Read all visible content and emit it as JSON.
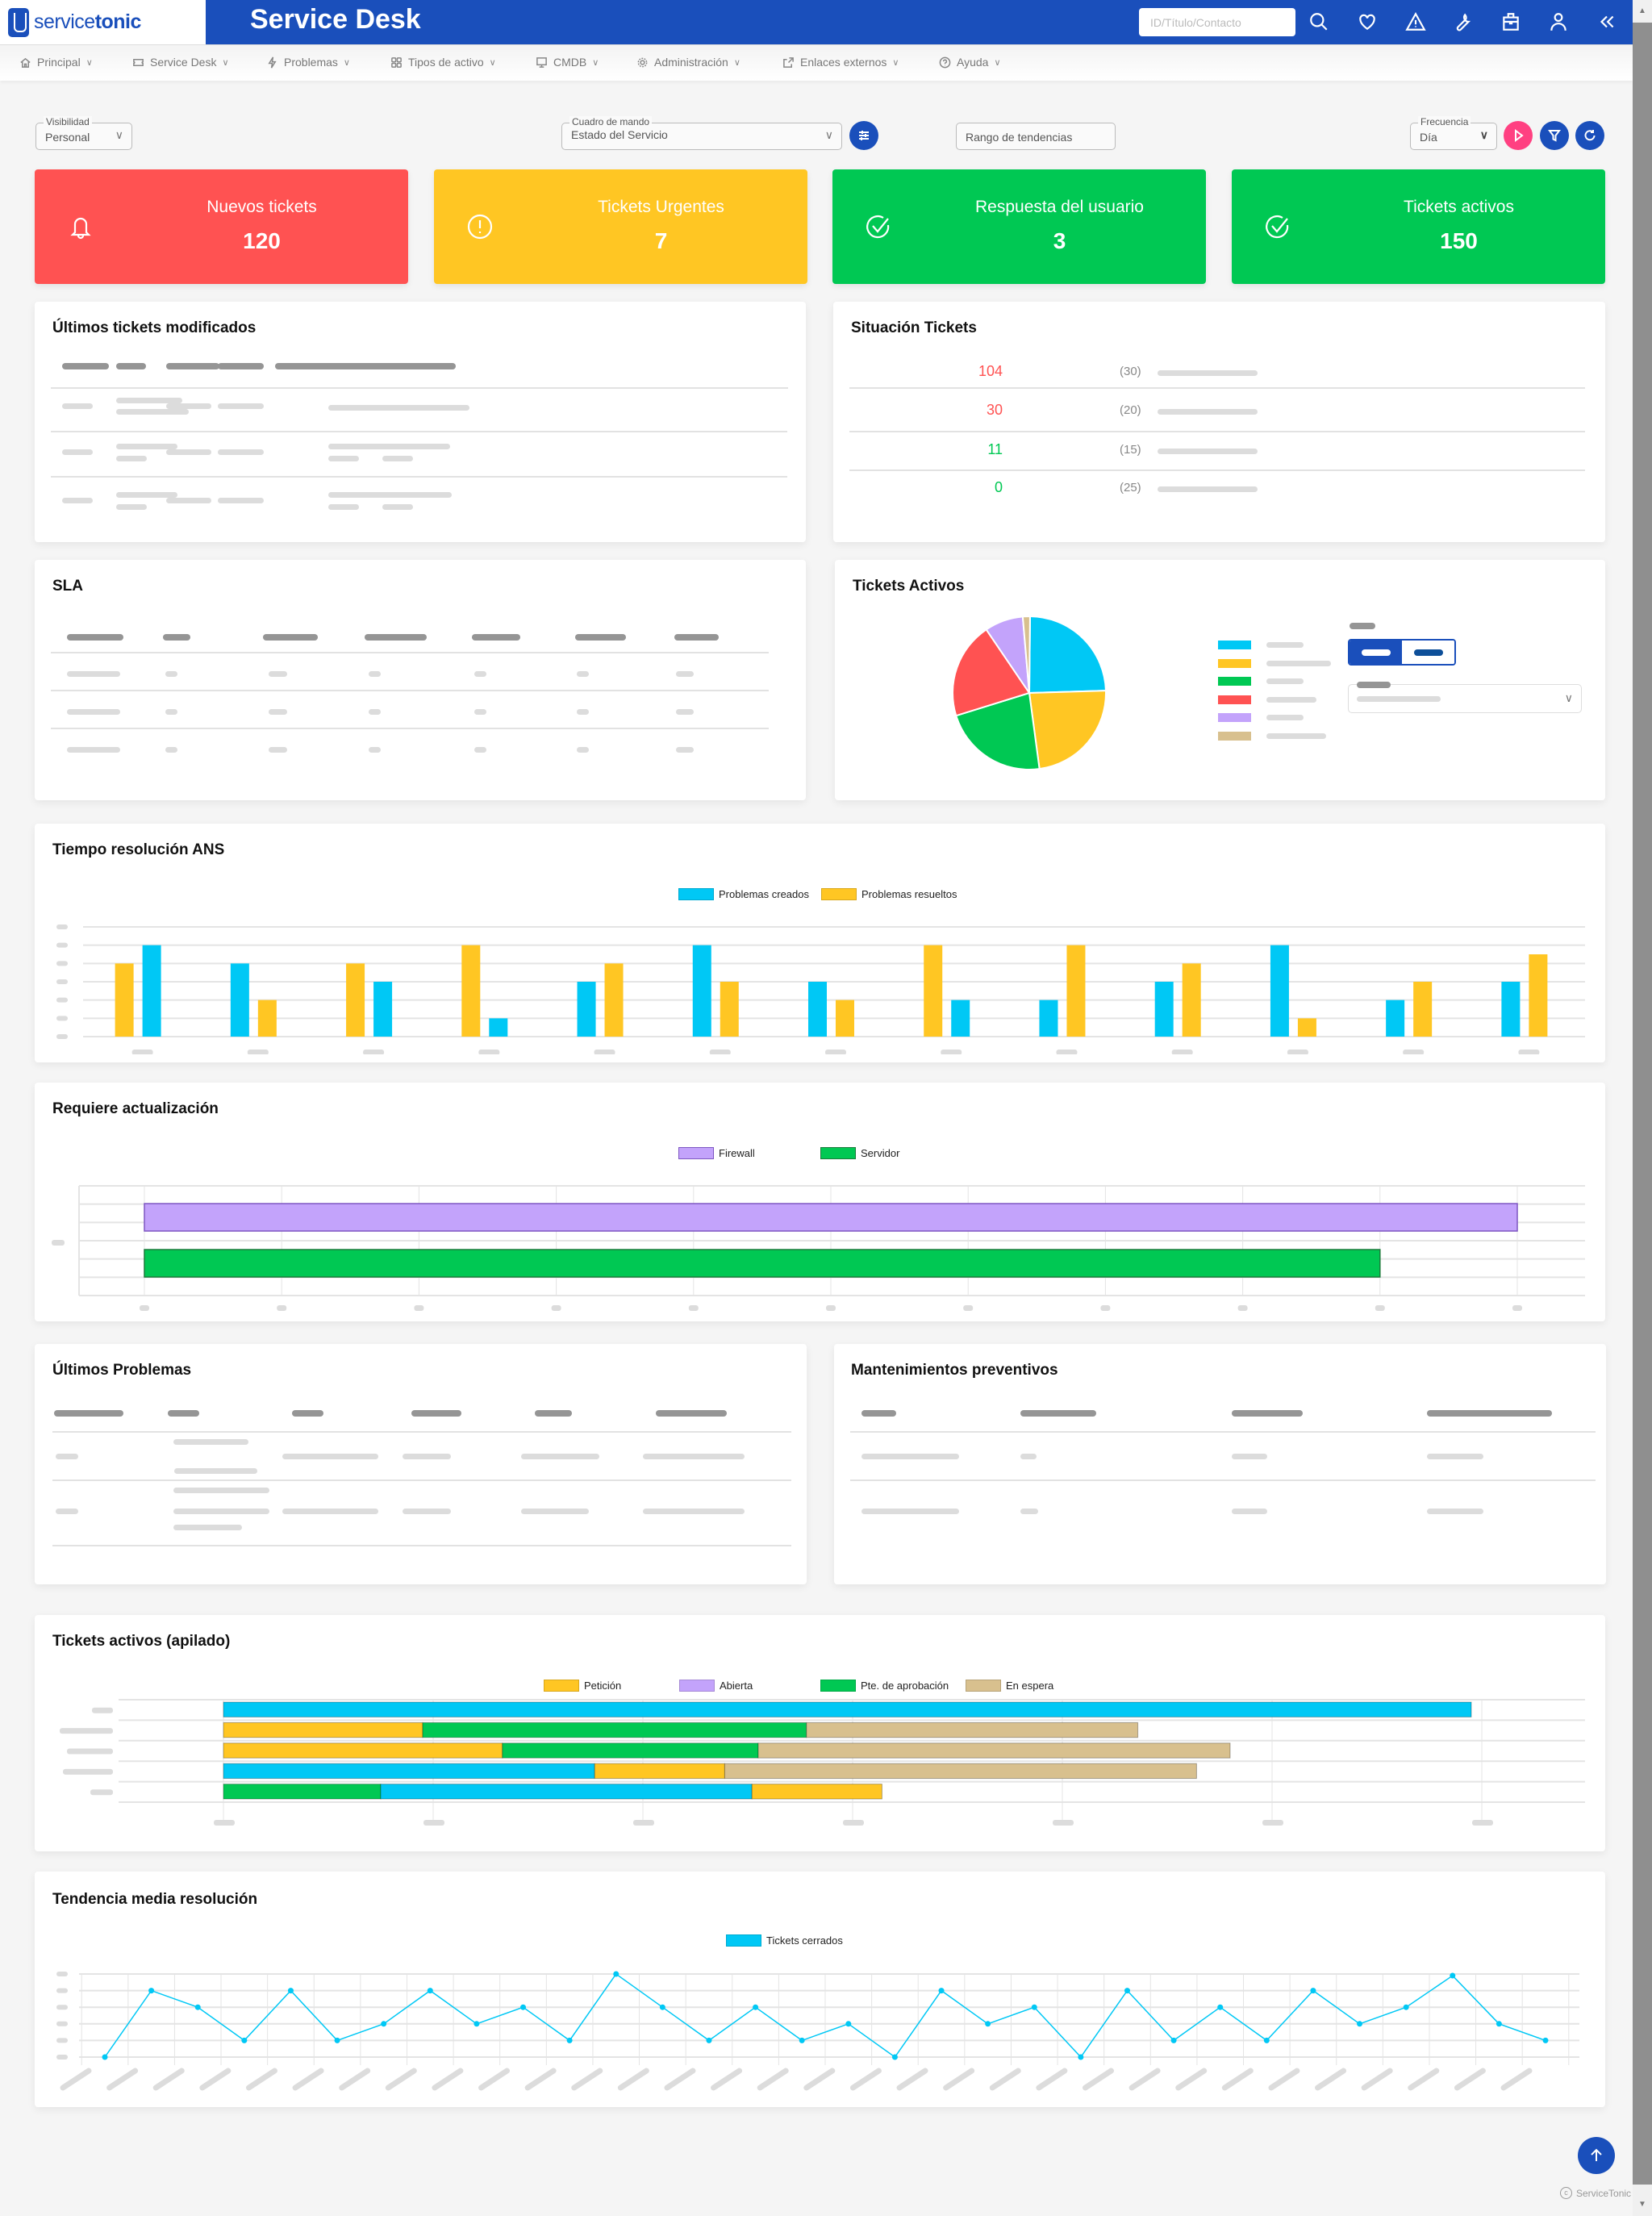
{
  "header": {
    "logo_prefix": "service",
    "logo_bold": "tonic",
    "title": "Service Desk",
    "search_placeholder": "ID/Título/Contacto",
    "icons": [
      "search-icon",
      "heart-icon",
      "warning-icon",
      "wrench-icon",
      "toolbox-icon",
      "user-icon",
      "collapse-icon"
    ]
  },
  "nav": [
    {
      "label": "Principal",
      "icon": "home-icon"
    },
    {
      "label": "Service Desk",
      "icon": "ticket-icon"
    },
    {
      "label": "Problemas",
      "icon": "bolt-icon"
    },
    {
      "label": "Tipos de activo",
      "icon": "grid-icon"
    },
    {
      "label": "CMDB",
      "icon": "monitor-icon"
    },
    {
      "label": "Administración",
      "icon": "gear-icon"
    },
    {
      "label": "Enlaces externos",
      "icon": "external-link-icon"
    },
    {
      "label": "Ayuda",
      "icon": "help-icon"
    }
  ],
  "filters": {
    "visibilidad": {
      "label": "Visibilidad",
      "value": "Personal"
    },
    "cuadro": {
      "label": "Cuadro de mando",
      "value": "Estado del Servicio"
    },
    "rango": {
      "placeholder": "Rango de tendencias"
    },
    "frecuencia": {
      "label": "Frecuencia",
      "value": "Día"
    }
  },
  "kpis": [
    {
      "label": "Nuevos tickets",
      "value": "120",
      "color": "#ff5252",
      "icon": "bell-icon"
    },
    {
      "label": "Tickets Urgentes",
      "value": "7",
      "color": "#ffc623",
      "icon": "alert-circle-icon"
    },
    {
      "label": "Respuesta del usuario",
      "value": "3",
      "color": "#00c853",
      "icon": "check-circle-icon"
    },
    {
      "label": "Tickets activos",
      "value": "150",
      "color": "#00c853",
      "icon": "check-circle-icon"
    }
  ],
  "cards": {
    "ultimos_tickets": "Últimos tickets modificados",
    "situacion": "Situación Tickets",
    "sla": "SLA",
    "tickets_activos": "Tickets Activos",
    "tiempo_ans": "Tiempo resolución ANS",
    "requiere": "Requiere actualización",
    "ultimos_problemas": "Últimos Problemas",
    "mantenimientos": "Mantenimientos preventivos",
    "apilado": "Tickets activos (apilado)",
    "tendencia": "Tendencia media resolución"
  },
  "situacion": [
    {
      "value": "104",
      "count": "(30)",
      "color": "#ff5252"
    },
    {
      "value": "30",
      "count": "(20)",
      "color": "#ff5252"
    },
    {
      "value": "11",
      "count": "(15)",
      "color": "#00c853"
    },
    {
      "value": "0",
      "count": "(25)",
      "color": "#00c853"
    }
  ],
  "footer": {
    "copyright": "ServiceTonic"
  },
  "chart_data": [
    {
      "id": "tickets-activos-pie",
      "type": "pie",
      "title": "Tickets Activos",
      "slices": [
        {
          "value": 24,
          "color": "#00c8f5"
        },
        {
          "value": 23,
          "color": "#ffc623"
        },
        {
          "value": 22,
          "color": "#00c853"
        },
        {
          "value": 20,
          "color": "#ff5252"
        },
        {
          "value": 8,
          "color": "#c3a3fb"
        },
        {
          "value": 1.5,
          "color": "#d8c08e"
        }
      ]
    },
    {
      "id": "tiempo-resolucion-ans",
      "type": "bar",
      "title": "Tiempo resolución ANS",
      "ylim": [
        0,
        6
      ],
      "grid": true,
      "legend": "top-center",
      "series": [
        {
          "name": "Problemas creados",
          "color": "#00c8f5",
          "values": [
            5,
            4,
            3,
            1,
            3,
            5,
            3,
            2,
            2,
            3,
            5,
            2,
            3
          ]
        },
        {
          "name": "Problemas resueltos",
          "color": "#ffc623",
          "values": [
            4,
            2,
            4,
            5,
            4,
            3,
            2,
            5,
            5,
            4,
            1,
            3,
            4.5
          ]
        }
      ],
      "order_first": [
        "resueltos",
        "creados",
        "resueltos",
        "resueltos",
        "creados",
        "creados",
        "creados",
        "resueltos",
        "creados",
        "creados",
        "creados",
        "creados",
        "creados"
      ]
    },
    {
      "id": "requiere-actualizacion",
      "type": "bar",
      "orientation": "horizontal",
      "title": "Requiere actualización",
      "xlim": [
        0,
        10
      ],
      "grid": true,
      "legend": "top-center",
      "series": [
        {
          "name": "Firewall",
          "color": "#c3a3fb",
          "value": 10
        },
        {
          "name": "Servidor",
          "color": "#00c853",
          "value": 9
        }
      ]
    },
    {
      "id": "tickets-activos-apilado",
      "type": "bar",
      "orientation": "horizontal",
      "stacked": true,
      "title": "Tickets activos (apilado)",
      "xlim": [
        0,
        6
      ],
      "grid": true,
      "legend": "top-center",
      "legend_items": [
        {
          "name": "Petición",
          "color": "#ffc623"
        },
        {
          "name": "Abierta",
          "color": "#c3a3fb"
        },
        {
          "name": "Pte. de aprobación",
          "color": "#00c853"
        },
        {
          "name": "En espera",
          "color": "#d8c08e"
        }
      ],
      "rows": [
        [
          {
            "color": "#00c8f5",
            "value": 5.95
          }
        ],
        [
          {
            "color": "#ffc623",
            "value": 0.95
          },
          {
            "color": "#00c853",
            "value": 1.83
          },
          {
            "color": "#d8c08e",
            "value": 1.58
          }
        ],
        [
          {
            "color": "#ffc623",
            "value": 1.33
          },
          {
            "color": "#00c853",
            "value": 1.22
          },
          {
            "color": "#d8c08e",
            "value": 2.25
          }
        ],
        [
          {
            "color": "#00c8f5",
            "value": 1.77
          },
          {
            "color": "#ffc623",
            "value": 0.62
          },
          {
            "color": "#d8c08e",
            "value": 2.25
          }
        ],
        [
          {
            "color": "#00c853",
            "value": 0.75
          },
          {
            "color": "#00c8f5",
            "value": 1.77
          },
          {
            "color": "#ffc623",
            "value": 0.62
          }
        ]
      ]
    },
    {
      "id": "tendencia-media-resolucion",
      "type": "line",
      "title": "Tendencia media resolución",
      "ylim": [
        0,
        5
      ],
      "grid": true,
      "legend": "top-center",
      "series": [
        {
          "name": "Tickets cerrados",
          "color": "#00c8f5",
          "values": [
            0,
            4,
            3,
            1,
            4,
            1,
            2,
            4,
            2,
            3,
            1,
            5,
            3,
            1,
            3,
            1,
            2,
            0,
            4,
            2,
            3,
            0,
            4,
            1,
            3,
            1,
            4,
            2,
            3,
            4.9,
            2,
            1
          ]
        }
      ]
    }
  ]
}
